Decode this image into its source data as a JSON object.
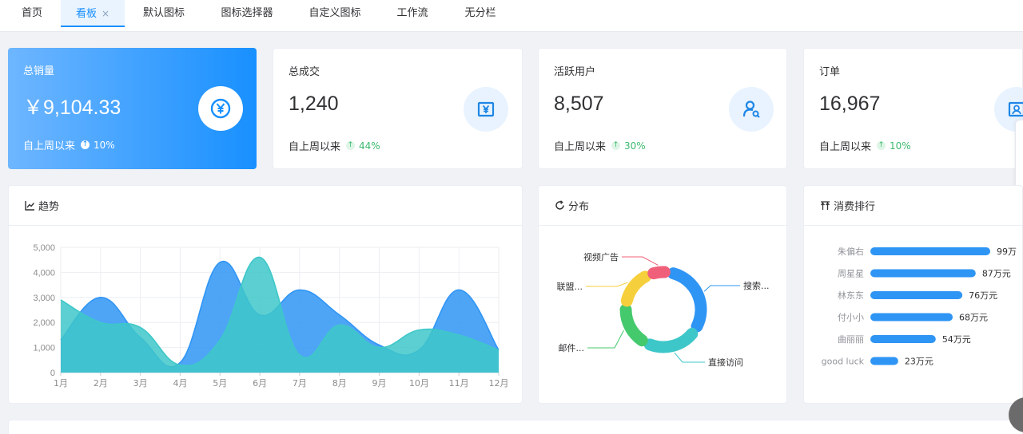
{
  "tabs": [
    {
      "label": "首页",
      "active": false
    },
    {
      "label": "看板",
      "active": true,
      "close": "×"
    },
    {
      "label": "默认图标",
      "active": false
    },
    {
      "label": "图标选择器",
      "active": false
    },
    {
      "label": "自定义图标",
      "active": false
    },
    {
      "label": "工作流",
      "active": false
    },
    {
      "label": "无分栏",
      "active": false
    }
  ],
  "stats": [
    {
      "title": "总销量",
      "value": "￥9,104.33",
      "foot_label": "自上周以来",
      "pct": "10%",
      "icon": "yen-icon"
    },
    {
      "title": "总成交",
      "value": "1,240",
      "foot_label": "自上周以来",
      "pct": "44%",
      "icon": "money-icon"
    },
    {
      "title": "活跃用户",
      "value": "8,507",
      "foot_label": "自上周以来",
      "pct": "30%",
      "icon": "user-search-icon"
    },
    {
      "title": "订单",
      "value": "16,967",
      "foot_label": "自上周以来",
      "pct": "10%",
      "icon": "order-icon"
    }
  ],
  "panels": {
    "trend": {
      "title": "趋势",
      "icon": "line-chart-icon"
    },
    "dist": {
      "title": "分布",
      "icon": "refresh-icon"
    },
    "rank": {
      "title": "消费排行",
      "icon": "sort-icon"
    }
  },
  "chart_data": [
    {
      "type": "area",
      "categories": [
        "1月",
        "2月",
        "3月",
        "4月",
        "5月",
        "6月",
        "7月",
        "8月",
        "9月",
        "10月",
        "11月",
        "12月"
      ],
      "ylim": [
        0,
        5000
      ],
      "yticks": [
        "0",
        "1,000",
        "2,000",
        "3,000",
        "4,000",
        "5,000"
      ],
      "grid": true,
      "series": [
        {
          "values": [
            1300,
            3000,
            1400,
            400,
            4400,
            2300,
            3300,
            2300,
            1100,
            900,
            3300,
            900
          ],
          "color": "#2f95f5"
        },
        {
          "values": [
            2900,
            2000,
            1800,
            300,
            1300,
            4600,
            700,
            1900,
            1000,
            1700,
            1500,
            900
          ],
          "color": "#3ec7c9"
        }
      ]
    },
    {
      "type": "pie",
      "slices": [
        {
          "name": "搜索...",
          "value": 30,
          "color": "#2f95f5"
        },
        {
          "name": "直接访问",
          "value": 22,
          "color": "#3ec7c9"
        },
        {
          "name": "邮件...",
          "value": 18,
          "color": "#45c96d"
        },
        {
          "name": "联盟...",
          "value": 16,
          "color": "#f6cf3c"
        },
        {
          "name": "视频广告",
          "value": 8,
          "color": "#f1607a"
        }
      ]
    },
    {
      "type": "bar",
      "categories": [
        "朱偏右",
        "周星星",
        "林东东",
        "付小小",
        "曲丽丽",
        "good luck"
      ],
      "values": [
        99,
        87,
        76,
        68,
        54,
        23
      ],
      "labels": [
        "99万",
        "87万元",
        "76万元",
        "68万元",
        "54万元",
        "23万元"
      ],
      "color": "#2f95f5"
    }
  ]
}
